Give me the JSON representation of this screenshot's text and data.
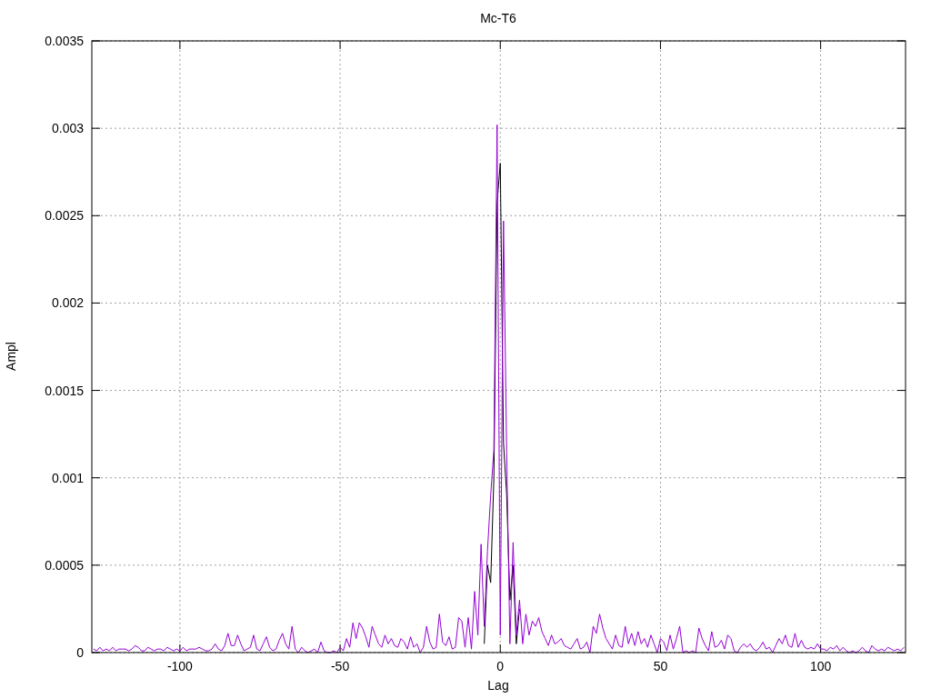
{
  "chart": {
    "chart_data": {
      "type": "line",
      "grid": true,
      "title": "Mc-T6",
      "xlabel": "Lag",
      "ylabel": "Ampl",
      "xlim": [
        -127.5,
        126.5
      ],
      "ylim": [
        0,
        0.0035
      ],
      "xticks": [
        -100,
        -50,
        0,
        50,
        100
      ],
      "yticks": [
        0,
        0.0005,
        0.001,
        0.0015,
        0.002,
        0.0025,
        0.003,
        0.0035
      ],
      "x": [
        -127,
        -126,
        -125,
        -124,
        -123,
        -122,
        -121,
        -120,
        -119,
        -118,
        -117,
        -116,
        -115,
        -114,
        -113,
        -112,
        -111,
        -110,
        -109,
        -108,
        -107,
        -106,
        -105,
        -104,
        -103,
        -102,
        -101,
        -100,
        -99,
        -98,
        -97,
        -96,
        -95,
        -94,
        -93,
        -92,
        -91,
        -90,
        -89,
        -88,
        -87,
        -86,
        -85,
        -84,
        -83,
        -82,
        -81,
        -80,
        -79,
        -78,
        -77,
        -76,
        -75,
        -74,
        -73,
        -72,
        -71,
        -70,
        -69,
        -68,
        -67,
        -66,
        -65,
        -64,
        -63,
        -62,
        -61,
        -60,
        -59,
        -58,
        -57,
        -56,
        -55,
        -54,
        -53,
        -52,
        -51,
        -50,
        -49,
        -48,
        -47,
        -46,
        -45,
        -44,
        -43,
        -42,
        -41,
        -40,
        -39,
        -38,
        -37,
        -36,
        -35,
        -34,
        -33,
        -32,
        -31,
        -30,
        -29,
        -28,
        -27,
        -26,
        -25,
        -24,
        -23,
        -22,
        -21,
        -20,
        -19,
        -18,
        -17,
        -16,
        -15,
        -14,
        -13,
        -12,
        -11,
        -10,
        -9,
        -8,
        -7,
        -6,
        -5,
        -4,
        -3,
        -2,
        -1,
        0,
        1,
        2,
        3,
        4,
        5,
        6,
        7,
        8,
        9,
        10,
        11,
        12,
        13,
        14,
        15,
        16,
        17,
        18,
        19,
        20,
        21,
        22,
        23,
        24,
        25,
        26,
        27,
        28,
        29,
        30,
        31,
        32,
        33,
        34,
        35,
        36,
        37,
        38,
        39,
        40,
        41,
        42,
        43,
        44,
        45,
        46,
        47,
        48,
        49,
        50,
        51,
        52,
        53,
        54,
        55,
        56,
        57,
        58,
        59,
        60,
        61,
        62,
        63,
        64,
        65,
        66,
        67,
        68,
        69,
        70,
        71,
        72,
        73,
        74,
        75,
        76,
        77,
        78,
        79,
        80,
        81,
        82,
        83,
        84,
        85,
        86,
        87,
        88,
        89,
        90,
        91,
        92,
        93,
        94,
        95,
        96,
        97,
        98,
        99,
        100,
        101,
        102,
        103,
        104,
        105,
        106,
        107,
        108,
        109,
        110,
        111,
        112,
        113,
        114,
        115,
        116,
        117,
        118,
        119,
        120,
        121,
        122,
        123,
        124,
        125,
        126
      ],
      "series": [
        {
          "color": "#000000",
          "values": [
            null,
            null,
            null,
            null,
            null,
            null,
            null,
            null,
            null,
            null,
            null,
            null,
            null,
            null,
            null,
            null,
            null,
            null,
            null,
            null,
            null,
            null,
            null,
            null,
            null,
            null,
            null,
            null,
            null,
            null,
            null,
            null,
            null,
            null,
            null,
            null,
            null,
            null,
            null,
            null,
            null,
            null,
            null,
            null,
            null,
            null,
            null,
            null,
            null,
            null,
            null,
            null,
            null,
            null,
            null,
            null,
            null,
            null,
            null,
            null,
            null,
            null,
            null,
            null,
            null,
            null,
            null,
            null,
            null,
            null,
            null,
            null,
            null,
            null,
            null,
            null,
            null,
            null,
            null,
            null,
            null,
            null,
            null,
            null,
            null,
            null,
            null,
            null,
            null,
            null,
            null,
            null,
            null,
            null,
            null,
            null,
            null,
            null,
            null,
            null,
            null,
            null,
            null,
            null,
            null,
            null,
            null,
            null,
            null,
            null,
            null,
            null,
            null,
            null,
            null,
            null,
            null,
            null,
            null,
            null,
            null,
            null,
            5e-05,
            0.0005,
            0.0004,
            0.001,
            0.00257,
            0.0028,
            0.0012,
            0.0009,
            0.0003,
            0.0005,
            5e-05,
            0.00025,
            null,
            null,
            null,
            null,
            null,
            null,
            null,
            null,
            null,
            null,
            null,
            null,
            null,
            null,
            null,
            null,
            null,
            null,
            null,
            null,
            null,
            null,
            null,
            null,
            null,
            null,
            null,
            null,
            null,
            null,
            null,
            null,
            null,
            null,
            null,
            null,
            null,
            null,
            null,
            null,
            null,
            null,
            null,
            null,
            null,
            null,
            null,
            null,
            null,
            null,
            null,
            null,
            null,
            null,
            null,
            null,
            null,
            null,
            null,
            null,
            null,
            null,
            null,
            null,
            null,
            null,
            null,
            null,
            null,
            null,
            null,
            null,
            null,
            null,
            null,
            null,
            null,
            null,
            null,
            null,
            null,
            null,
            null,
            null,
            null,
            null,
            null,
            null,
            null,
            null,
            null,
            null,
            null,
            null,
            null,
            null,
            null,
            null,
            null,
            null,
            null,
            null,
            null,
            null,
            null,
            null,
            null,
            null,
            null,
            null,
            null,
            null,
            null,
            null,
            null,
            null,
            null,
            null,
            null,
            null
          ]
        },
        {
          "color": "#9400d3",
          "values": [
            2e-05,
            1e-05,
            3e-05,
            1e-05,
            2e-05,
            1e-05,
            3e-05,
            1e-05,
            2e-05,
            2e-05,
            2e-05,
            1e-05,
            2e-05,
            4e-05,
            3e-05,
            1e-05,
            1e-05,
            3e-05,
            2e-05,
            1e-05,
            2e-05,
            2e-05,
            1e-05,
            3e-05,
            2e-05,
            1e-05,
            2e-05,
            1e-05,
            3e-05,
            1e-05,
            2e-05,
            2e-05,
            2e-05,
            3e-05,
            2e-05,
            1e-05,
            1e-05,
            2e-05,
            5e-05,
            2e-05,
            1e-05,
            4e-05,
            0.00011,
            4e-05,
            4e-05,
            0.0001,
            5e-05,
            1e-05,
            2e-05,
            3e-05,
            0.0001,
            2e-05,
            1e-05,
            5e-05,
            9e-05,
            3e-05,
            1e-05,
            2e-05,
            7e-05,
            0.00011,
            5e-05,
            2e-05,
            0.00015,
            2e-05,
            0,
            3e-05,
            1e-05,
            0,
            1e-05,
            2e-05,
            0,
            6e-05,
            1e-05,
            0,
            0,
            1e-05,
            0,
            3e-05,
            1e-05,
            8e-05,
            3e-05,
            0.00017,
            8e-05,
            0.00017,
            0.00014,
            9e-05,
            3e-05,
            0.00015,
            0.0001,
            5e-05,
            3e-05,
            0.0001,
            5e-05,
            8e-05,
            4e-05,
            3e-05,
            8e-05,
            6e-05,
            2e-05,
            9e-05,
            3e-05,
            5e-05,
            0,
            3e-05,
            0.00015,
            6e-05,
            2e-05,
            3e-05,
            0.00022,
            6e-05,
            4e-05,
            9e-05,
            2e-05,
            3e-05,
            0.0002,
            0.00018,
            3e-05,
            0.0002,
            2e-05,
            0.00035,
            0.0001,
            0.00062,
            0.00015,
            0.00058,
            0.0009,
            0.00116,
            0.00302,
            0.0001,
            0.00247,
            0.00114,
            5e-05,
            0.00063,
            0.0001,
            0.0003,
            5e-05,
            0.00022,
            0.0001,
            0.00018,
            0.00015,
            0.0002,
            0.00012,
            8e-05,
            4e-05,
            0.0001,
            5e-05,
            6e-05,
            8e-05,
            4e-05,
            3e-05,
            2e-05,
            5e-05,
            8e-05,
            2e-05,
            3e-05,
            6e-05,
            0,
            0.00015,
            0.00011,
            0.00022,
            0.00014,
            8e-05,
            5e-05,
            2e-05,
            0.0001,
            4e-05,
            3e-05,
            0.00015,
            5e-05,
            0.00011,
            4e-05,
            0.00012,
            5e-05,
            8e-05,
            3e-05,
            0.0001,
            5e-05,
            0,
            8e-05,
            6e-05,
            1e-05,
            0.0001,
            2e-05,
            8e-05,
            0.00015,
            0,
            1e-05,
            0,
            1e-05,
            0,
            0.00014,
            8e-05,
            4e-05,
            1e-05,
            0.00012,
            3e-05,
            4e-05,
            7e-05,
            2e-05,
            0.0001,
            8e-05,
            1e-05,
            0,
            3e-05,
            5e-05,
            3e-05,
            5e-05,
            2e-05,
            1e-05,
            3e-05,
            6e-05,
            2e-05,
            3e-05,
            0,
            4e-05,
            8e-05,
            5e-05,
            0.0001,
            4e-05,
            3e-05,
            0.00011,
            3e-05,
            7e-05,
            3e-05,
            2e-05,
            3e-05,
            2e-05,
            5e-05,
            2e-05,
            2e-05,
            1e-05,
            3e-05,
            2e-05,
            4e-05,
            1e-05,
            3e-05,
            1e-05,
            0,
            1e-05,
            0,
            1e-05,
            3e-05,
            1e-05,
            0,
            4e-05,
            2e-05,
            1e-05,
            2e-05,
            1e-05,
            3e-05,
            2e-05,
            1e-05,
            2e-05,
            1e-05,
            3e-05
          ]
        }
      ]
    }
  }
}
